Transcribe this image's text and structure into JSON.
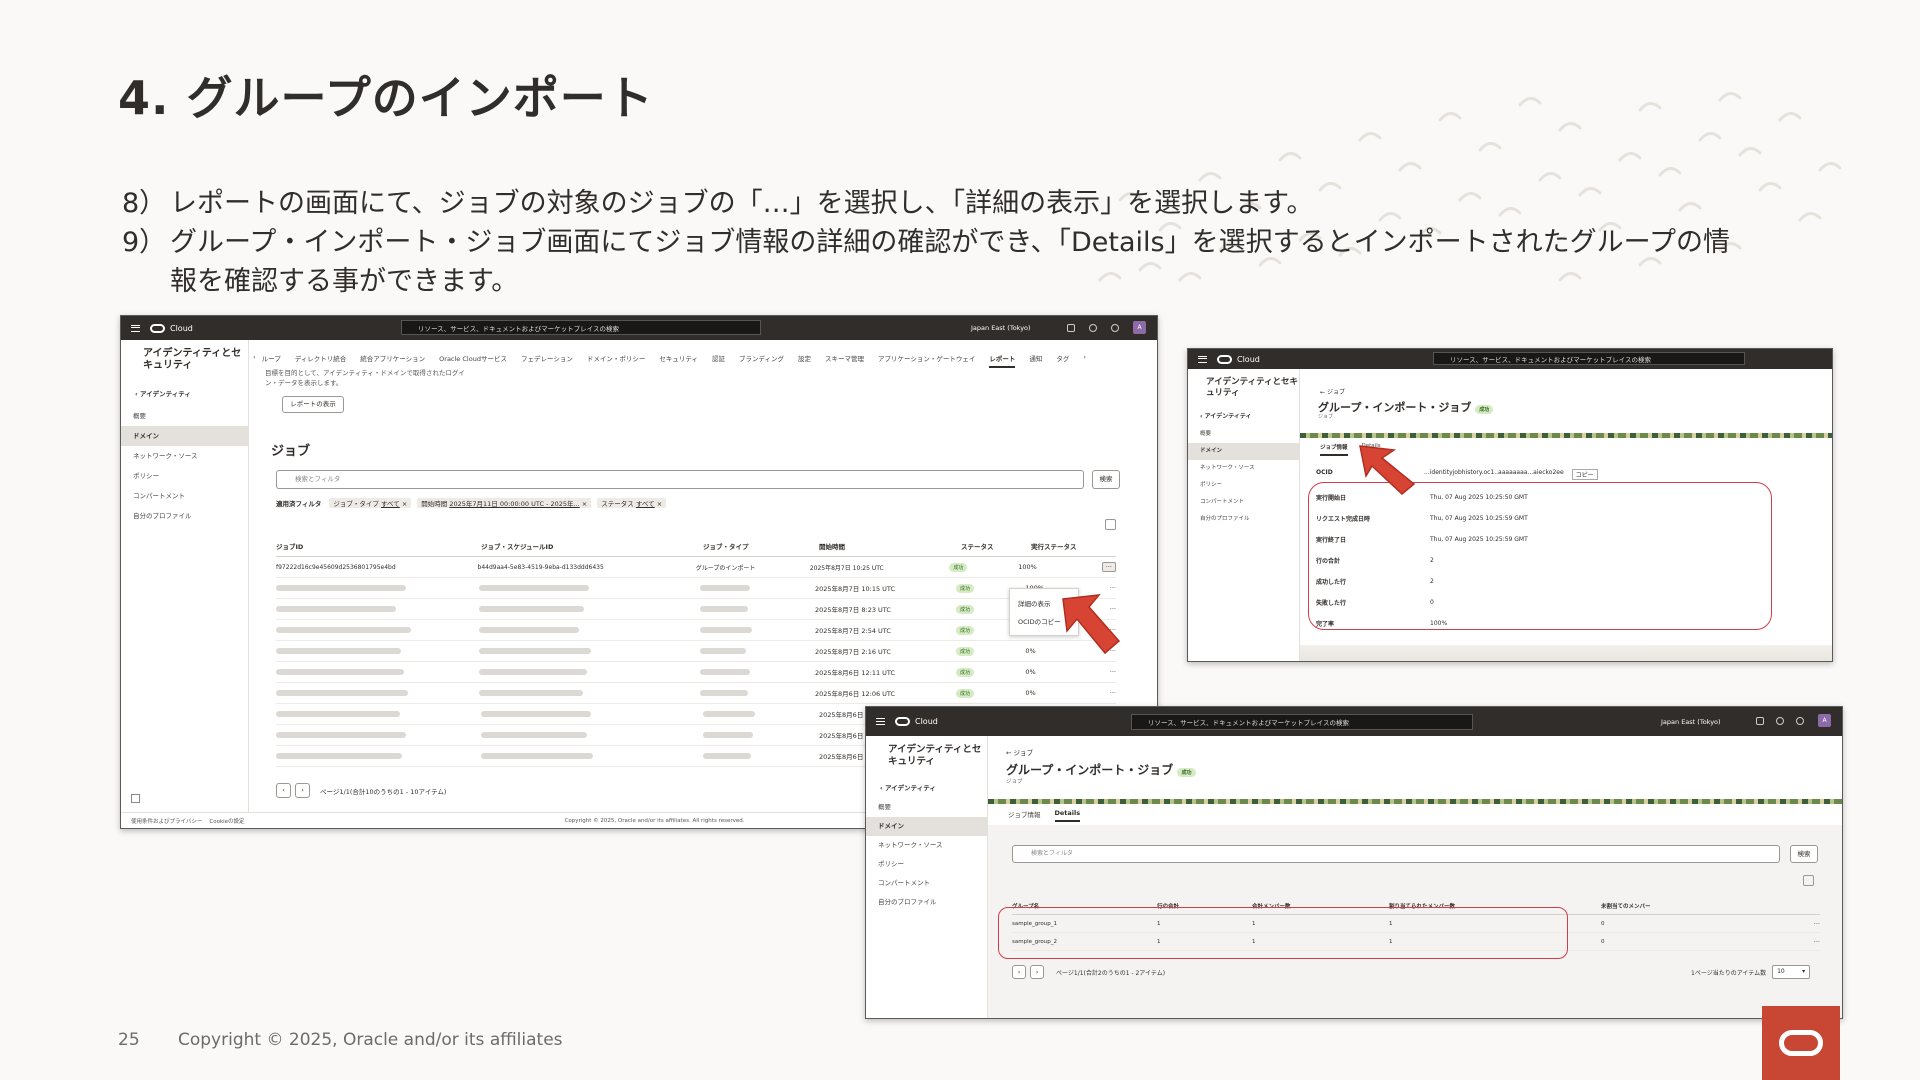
{
  "slide": {
    "title": "4. グループのインポート",
    "steps": [
      {
        "num": "8）",
        "text": "レポートの画面にて、ジョブの対象のジョブの「…」を選択し、「詳細の表示」を選択します。"
      },
      {
        "num": "9）",
        "text": "グループ・インポート・ジョブ画面にてジョブ情報の詳細の確認ができ、「Details」を選択するとインポートされたグループの情報を確認する事ができます。"
      }
    ],
    "page_number": "25",
    "copyright": "Copyright © 2025, Oracle and/or its affiliates"
  },
  "console": {
    "brand": "Cloud",
    "search_placeholder": "リソース、サービス、ドキュメントおよびマーケットプレイスの検索",
    "region": "Japan East (Tokyo)",
    "avatar": "A",
    "sidebar_title": "アイデンティティとセキュリティ",
    "sidebar_back": "アイデンティティ",
    "sidebar_items": [
      "概要",
      "ドメイン",
      "ネットワーク・ソース",
      "ポリシー",
      "コンパートメント",
      "自分のプロファイル"
    ],
    "sidebar_selected": "ドメイン"
  },
  "report_screen": {
    "nav_tabs": [
      "ループ",
      "ディレクトリ統合",
      "統合アプリケーション",
      "Oracle Cloudサービス",
      "フェデレーション",
      "ドメイン・ポリシー",
      "セキュリティ",
      "認証",
      "ブランディング",
      "設定",
      "スキーマ管理",
      "アプリケーション・ゲートウェイ",
      "レポート",
      "通知",
      "タグ"
    ],
    "active_nav_tab": "レポート",
    "info_text": "目標を目的として、アイデンティティ・ドメインで取得されたログイン・データを表示します。",
    "view_report_button": "レポートの表示",
    "section_title": "ジョブ",
    "filter_placeholder": "検索とフィルタ",
    "search_button": "検索",
    "applied_filter_label": "適用済フィルタ",
    "filters": [
      {
        "label": "ジョブ・タイプ",
        "value": "すべて"
      },
      {
        "label": "開始時間",
        "value": "2025年7月11日 00:00:00 UTC - 2025年..."
      },
      {
        "label": "ステータス",
        "value": "すべて"
      }
    ],
    "columns": [
      "ジョブID",
      "ジョブ・スケジュールID",
      "ジョブ・タイプ",
      "開始時間",
      "ステータス",
      "実行ステータス"
    ],
    "first_row": {
      "job_id": "f97222d16c9e45609d2536801795e4bd",
      "schedule_id": "b44d9aa4-5e83-4519-9eba-d133ddd6435",
      "type": "グループのインポート",
      "start": "2025年8月7日 10:25 UTC",
      "status": "成功",
      "progress": "100%"
    },
    "other_rows": [
      {
        "start": "2025年8月7日 10:15 UTC",
        "status": "成功",
        "progress": "100%"
      },
      {
        "start": "2025年8月7日 8:23 UTC",
        "status": "成功",
        "progress": "100%"
      },
      {
        "start": "2025年8月7日 2:54 UTC",
        "status": "成功",
        "progress": "0%"
      },
      {
        "start": "2025年8月7日 2:16 UTC",
        "status": "成功",
        "progress": "0%"
      },
      {
        "start": "2025年8月6日 12:11 UTC",
        "status": "成功",
        "progress": "0%"
      },
      {
        "start": "2025年8月6日 12:06 UTC",
        "status": "成功",
        "progress": "0%"
      },
      {
        "start": "2025年8月6日 11:5",
        "status": "",
        "progress": ""
      },
      {
        "start": "2025年8月6日 11:4",
        "status": "",
        "progress": ""
      },
      {
        "start": "2025年8月6日 11:2",
        "status": "",
        "progress": ""
      }
    ],
    "context_menu": [
      "詳細の表示",
      "OCIDのコピー"
    ],
    "pagination": "ページ1/1(合計10のうちの1 - 10アイテム)",
    "footer_links": "使用条件およびプライバシー    Cookieの設定",
    "footer_copy": "Copyright © 2025, Oracle and/or its affiliates. All rights reserved."
  },
  "job_info_screen": {
    "back_link": "ジョブ",
    "title": "グループ・インポート・ジョブ",
    "badge": "成功",
    "subtitle": "ジョブ",
    "tabs": [
      "ジョブ情報",
      "Details"
    ],
    "active_tab": "ジョブ情報",
    "ocid_label": "OCID",
    "ocid_value": "...identityjobhistory.oc1..aaaaaaaa...aiecko2ee",
    "copy_link": "コピー",
    "fields": [
      {
        "label": "実行開始日",
        "value": "Thu, 07 Aug 2025 10:25:50 GMT"
      },
      {
        "label": "リクエスト完成日時",
        "value": "Thu, 07 Aug 2025 10:25:59 GMT"
      },
      {
        "label": "実行終了日",
        "value": "Thu, 07 Aug 2025 10:25:59 GMT"
      },
      {
        "label": "行の合計",
        "value": "2"
      },
      {
        "label": "成功した行",
        "value": "2"
      },
      {
        "label": "失敗した行",
        "value": "0"
      },
      {
        "label": "完了率",
        "value": "100%"
      }
    ]
  },
  "details_screen": {
    "back_link": "ジョブ",
    "title": "グループ・インポート・ジョブ",
    "badge": "成功",
    "subtitle": "ジョブ",
    "tabs": [
      "ジョブ情報",
      "Details"
    ],
    "active_tab": "Details",
    "filter_placeholder": "検索とフィルタ",
    "search_button": "検索",
    "columns": [
      "グループ名",
      "行の合計",
      "合計メンバー数",
      "割り当てられたメンバー数",
      "未割当てのメンバー"
    ],
    "rows": [
      {
        "name": "sample_group_1",
        "rows": "1",
        "members": "1",
        "assigned": "1",
        "unassigned": "0"
      },
      {
        "name": "sample_group_2",
        "rows": "1",
        "members": "1",
        "assigned": "1",
        "unassigned": "0"
      }
    ],
    "pagination": "ページ1/1(合計2のうちの1 - 2アイテム)",
    "per_page_label": "1ページ当たりのアイテム数",
    "per_page_value": "10"
  }
}
